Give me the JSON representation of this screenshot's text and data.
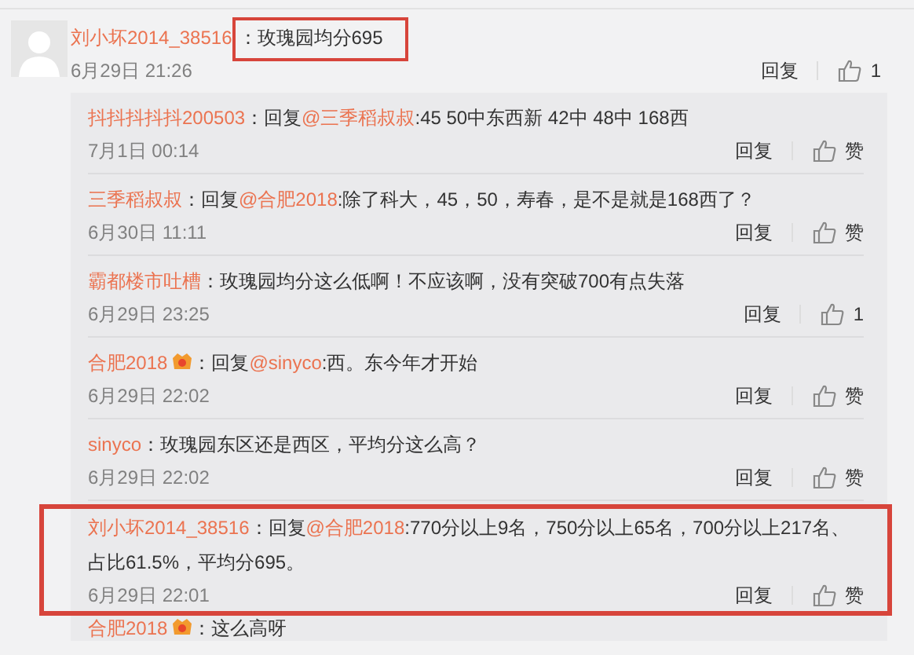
{
  "comment": {
    "author": "刘小坏2014_38516",
    "text": "：玫瑰园均分695",
    "highlighted": true,
    "time": "6月29日 21:26",
    "reply_label": "回复",
    "like": "1"
  },
  "replies": [
    {
      "author": "抖抖抖抖抖200503",
      "badge": false,
      "prefix": "：回复",
      "mention": "@三季稻叔叔",
      "body": ":45 50中东西新 42中 48中 168西",
      "time": "7月1日 00:14",
      "reply_label": "回复",
      "like": "赞",
      "highlighted": false
    },
    {
      "author": "三季稻叔叔",
      "badge": false,
      "prefix": "：回复",
      "mention": "@合肥2018",
      "body": ":除了科大，45，50，寿春，是不是就是168西了？",
      "time": "6月30日 11:11",
      "reply_label": "回复",
      "like": "赞",
      "highlighted": false
    },
    {
      "author": "霸都楼市吐槽",
      "badge": false,
      "prefix": "：玫瑰园均分这么低啊！不应该啊，没有突破700有点失落",
      "time": "6月29日 23:25",
      "reply_label": "回复",
      "like": "1",
      "highlighted": false
    },
    {
      "author": "合肥2018",
      "badge": true,
      "prefix": "：回复",
      "mention": "@sinyco",
      "body": ":西。东今年才开始",
      "time": "6月29日 22:02",
      "reply_label": "回复",
      "like": "赞",
      "highlighted": false
    },
    {
      "author": "sinyco",
      "badge": false,
      "prefix": "：玫瑰园东区还是西区，平均分这么高？",
      "time": "6月29日 22:02",
      "reply_label": "回复",
      "like": "赞",
      "highlighted": false
    },
    {
      "author": "刘小坏2014_38516",
      "badge": false,
      "prefix": "：回复",
      "mention": "@合肥2018",
      "body": ":770分以上9名，750分以上65名，700分以上217名、占比61.5%，平均分695。",
      "time": "6月29日 22:01",
      "reply_label": "回复",
      "like": "赞",
      "highlighted": true
    },
    {
      "author": "合肥2018",
      "badge": true,
      "prefix": "：这么高呀",
      "highlighted": false
    }
  ]
}
